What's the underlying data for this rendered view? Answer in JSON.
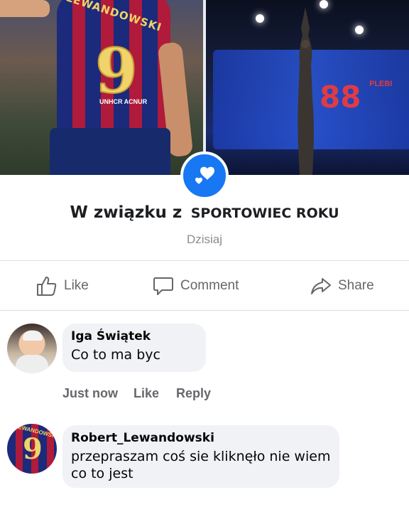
{
  "hero": {
    "left_jersey_name": "LEWANDOWSKI",
    "left_jersey_number": "9",
    "left_badge": "UNHCR ACNUR",
    "right_stage_number": "88",
    "right_stage_word": "PLEBI"
  },
  "event": {
    "prefix": "W związku z",
    "name": "SPORTOWIEC ROKU",
    "date": "Dzisiaj"
  },
  "actions": {
    "like": "Like",
    "comment": "Comment",
    "share": "Share"
  },
  "comments": [
    {
      "author": "Iga Świątek",
      "text": "Co to ma byc",
      "time": "Just now",
      "like": "Like",
      "reply": "Reply"
    },
    {
      "author": "Robert_Lewandowski",
      "text": "przepraszam coś sie kliknęło nie wiem co to jest",
      "avatar_number": "9",
      "avatar_name": "LEWANDOWSKI"
    }
  ],
  "colors": {
    "accent": "#1877f2",
    "muted": "#65676b",
    "bubble": "#f0f2f5"
  }
}
